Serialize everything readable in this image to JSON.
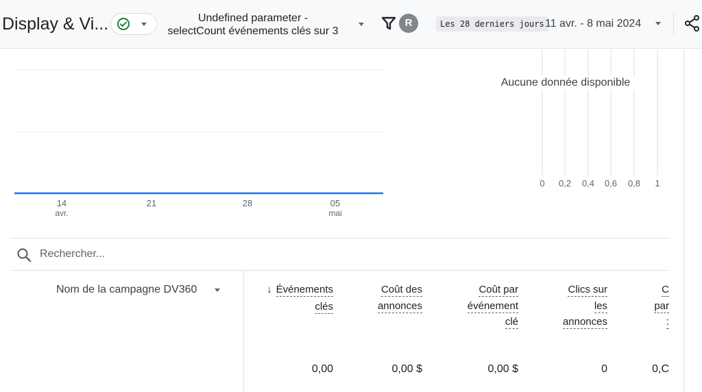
{
  "header": {
    "title": "Display & Vi...",
    "comparison_line1": "Undefined parameter -",
    "comparison_line2": "selectCount événements clés sur 3",
    "avatar_letter": "R",
    "range_label": "Les 28 derniers jours",
    "date_range": "11 avr. - 8 mai 2024",
    "icons": [
      "check-circle-icon",
      "chevron-down-icon",
      "filter-icon",
      "share-icon"
    ],
    "accent_color": "#188038"
  },
  "chart": {
    "line_color": "#1a73e8",
    "x_ticks": [
      {
        "day": "14",
        "month": "avr."
      },
      {
        "day": "21",
        "month": ""
      },
      {
        "day": "28",
        "month": ""
      },
      {
        "day": "05",
        "month": "mai"
      }
    ]
  },
  "chart_data": {
    "type": "line",
    "categories": [
      "11 avr.",
      "8 mai"
    ],
    "series": [
      {
        "values": [
          0,
          0
        ]
      }
    ],
    "x_tick_labels": [
      "14 avr.",
      "21",
      "28",
      "05 mai"
    ],
    "grid": true
  },
  "mini_chart": {
    "empty_message": "Aucune donnée disponible",
    "x_ticks": [
      "0",
      "0,2",
      "0,4",
      "0,6",
      "0,8",
      "1"
    ]
  },
  "search": {
    "placeholder": "Rechercher..."
  },
  "table": {
    "dimension_header": "Nom de la campagne DV360",
    "sort_arrow": "↓",
    "columns": [
      {
        "lines": [
          "Événements",
          "clés"
        ],
        "value": "0,00",
        "sorted": true
      },
      {
        "lines": [
          "Coût des",
          "annonces"
        ],
        "value": "0,00 $"
      },
      {
        "lines": [
          "Coût par",
          "événement",
          "clé"
        ],
        "value": "0,00 $"
      },
      {
        "lines": [
          "Clics sur",
          "les",
          "annonces"
        ],
        "value": "0"
      },
      {
        "lines": [
          "C",
          "par",
          ":"
        ],
        "value": "0,C"
      }
    ]
  }
}
